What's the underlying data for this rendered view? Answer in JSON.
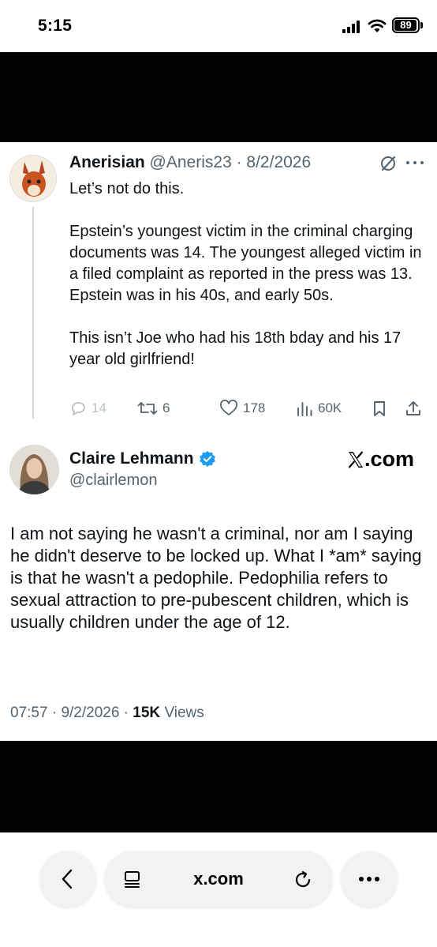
{
  "status_bar": {
    "time": "5:15",
    "battery": "89"
  },
  "reply": {
    "name": "Anerisian",
    "handle": "@Aneris23",
    "date": "8/2/2026",
    "paragraphs": [
      "Let’s not do this.",
      "Epstein’s youngest victim in the criminal charging documents was 14. The youngest alleged victim in a filed complaint as reported in the press was 13. Epstein was in his 40s, and early 50s.",
      "This isn’t Joe who had his 18th bday and his 17 year old girlfriend!"
    ],
    "counts": {
      "replies": "14",
      "reposts": "6",
      "likes": "178",
      "views": "60K"
    }
  },
  "main": {
    "name": "Claire Lehmann",
    "handle": "@clairlemon",
    "logo_text": ".com",
    "text": "I am not saying he wasn't a criminal, nor am I saying he didn't deserve to be locked up. What I *am* saying is that he wasn't a pedophile. Pedophilia refers to sexual attraction to pre-pubescent children, which is usually children under the age of 12.",
    "time": "07:57",
    "date": "9/2/2026",
    "views_count": "15K",
    "views_label": "Views"
  },
  "browser": {
    "url": "x.com"
  },
  "colors": {
    "text": "#0f1419",
    "secondary": "#536471",
    "verified": "#1d9bf0",
    "band": "#000000"
  },
  "icons": [
    "signal-icon",
    "wifi-icon",
    "battery-icon",
    "grok-icon",
    "more-icon",
    "reply-icon",
    "repost-icon",
    "like-icon",
    "views-icon",
    "bookmark-icon",
    "share-icon",
    "verified-icon",
    "x-logo-icon",
    "back-icon",
    "tabs-icon",
    "reload-icon",
    "menu-dots-icon"
  ]
}
